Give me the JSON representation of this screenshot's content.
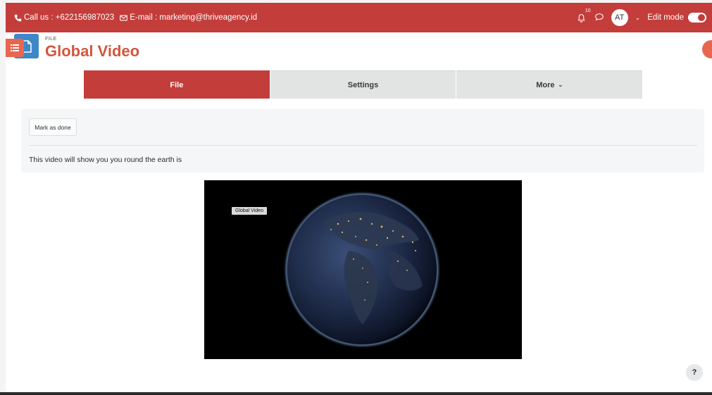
{
  "topbar": {
    "phone_label": "Call us : +622156987023",
    "email_label": "E-mail : marketing@thriveagency.id",
    "notification_count": "10",
    "avatar_initials": "AT",
    "edit_mode_label": "Edit mode",
    "edit_mode_on": true,
    "bar_color": "#c33d3b"
  },
  "header": {
    "subtitle": "FILE",
    "title": "Global Video",
    "title_color": "#d3553e",
    "icon": "document-icon"
  },
  "tabs": [
    {
      "label": "File",
      "active": true
    },
    {
      "label": "Settings",
      "active": false
    },
    {
      "label": "More",
      "active": false,
      "dropdown": true
    }
  ],
  "content": {
    "mark_done_label": "Mark as done",
    "description": "This video will show you you round the earth is"
  },
  "video": {
    "title_overlay": "Global Video"
  },
  "help": {
    "label": "?"
  }
}
